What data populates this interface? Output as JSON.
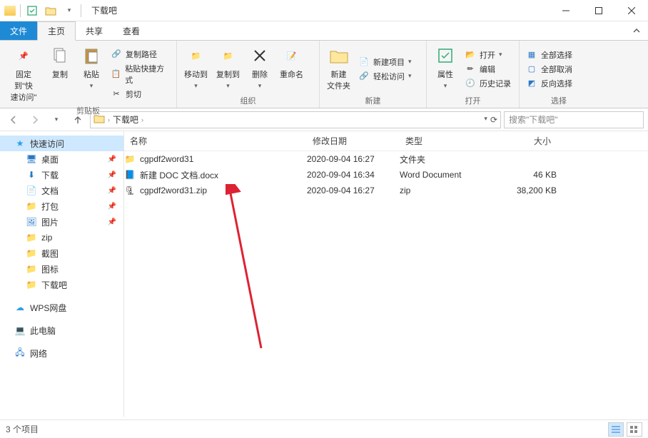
{
  "title": "下载吧",
  "tabs": {
    "file": "文件",
    "home": "主页",
    "share": "共享",
    "view": "查看"
  },
  "ribbon": {
    "pin": "固定到\"快\n速访问\"",
    "copy": "复制",
    "paste": "粘贴",
    "copy_path": "复制路径",
    "paste_shortcut": "粘贴快捷方式",
    "cut": "剪切",
    "g_clipboard": "剪贴板",
    "move_to": "移动到",
    "copy_to": "复制到",
    "delete": "删除",
    "rename": "重命名",
    "g_organize": "组织",
    "new_folder": "新建\n文件夹",
    "new_item": "新建项目",
    "easy_access": "轻松访问",
    "g_new": "新建",
    "properties": "属性",
    "open": "打开",
    "edit": "编辑",
    "history": "历史记录",
    "g_open": "打开",
    "select_all": "全部选择",
    "select_none": "全部取消",
    "invert": "反向选择",
    "g_select": "选择"
  },
  "breadcrumb": {
    "root": "下载吧"
  },
  "search_placeholder": "搜索\"下载吧\"",
  "sidebar": {
    "quick_access": "快速访问",
    "desktop": "桌面",
    "downloads": "下载",
    "documents": "文档",
    "pack": "打包",
    "pictures": "图片",
    "zip": "zip",
    "screenshots": "截图",
    "icons": "图标",
    "xiazaiba": "下载吧",
    "wps": "WPS网盘",
    "this_pc": "此电脑",
    "network": "网络"
  },
  "columns": {
    "name": "名称",
    "date": "修改日期",
    "type": "类型",
    "size": "大小"
  },
  "files": [
    {
      "name": "cgpdf2word31",
      "date": "2020-09-04 16:27",
      "type": "文件夹",
      "size": "",
      "icon": "folder"
    },
    {
      "name": "新建 DOC 文档.docx",
      "date": "2020-09-04 16:34",
      "type": "Word Document",
      "size": "46 KB",
      "icon": "doc"
    },
    {
      "name": "cgpdf2word31.zip",
      "date": "2020-09-04 16:27",
      "type": "zip",
      "size": "38,200 KB",
      "icon": "zip"
    }
  ],
  "status": "3 个项目"
}
